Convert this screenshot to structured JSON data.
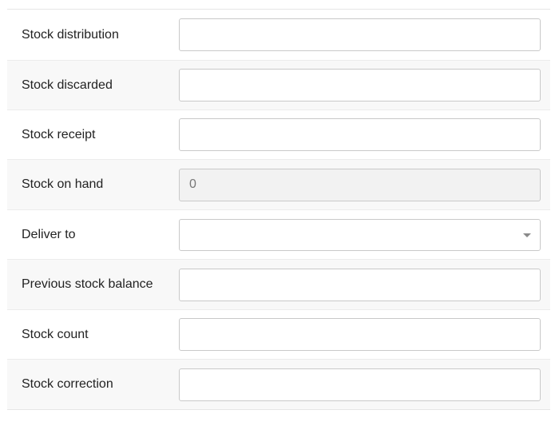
{
  "form": {
    "rows": [
      {
        "label": "Stock distribution",
        "value": ""
      },
      {
        "label": "Stock discarded",
        "value": ""
      },
      {
        "label": "Stock receipt",
        "value": ""
      },
      {
        "label": "Stock on hand",
        "value": "0"
      },
      {
        "label": "Deliver to",
        "value": ""
      },
      {
        "label": "Previous stock balance",
        "value": ""
      },
      {
        "label": "Stock count",
        "value": ""
      },
      {
        "label": "Stock correction",
        "value": ""
      }
    ]
  },
  "icons": {
    "dropdown": "chevron-down-icon"
  },
  "colors": {
    "row_alt_background": "#f8f8f8",
    "readonly_background": "#f2f2f2",
    "border": "#c9c9c9"
  }
}
